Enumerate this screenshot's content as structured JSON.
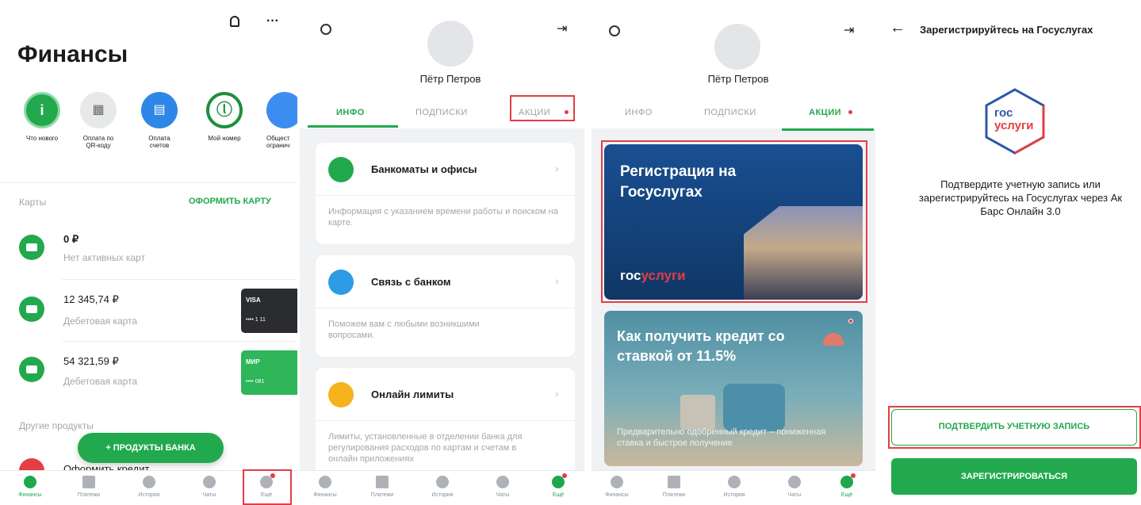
{
  "s1": {
    "title": "Финансы",
    "stories": [
      "Что нового",
      "Оплата по QR-коду",
      "Оплата счетов",
      "Мой номер",
      "Общест огранич"
    ],
    "cards_label": "Карты",
    "cards_action": "ОФОРМИТЬ КАРТУ",
    "accounts": [
      {
        "amount": "0 ₽",
        "desc": "Нет активных карт"
      },
      {
        "amount": "12 345,74 ₽",
        "desc": "Дебетовая карта",
        "chip_brand": "VISA",
        "chip_num": "•••• 1 11"
      },
      {
        "amount": "54 321,59 ₽",
        "desc": "Дебетовая карта",
        "chip_brand": "МИР",
        "chip_num": "•••• 081"
      }
    ],
    "other_label": "Другие продукты",
    "products_btn": "+ ПРОДУКТЫ БАНКА",
    "credit": "Оформить кредит"
  },
  "tabs": [
    "Финансы",
    "Платежи",
    "История",
    "Чаты",
    "Ещё"
  ],
  "profile": {
    "name": "Пётр Петров",
    "tab_info": "ИНФО",
    "tab_subs": "ПОДПИСКИ",
    "tab_promo": "АКЦИИ"
  },
  "s2": {
    "items": [
      {
        "title": "Банкоматы и офисы",
        "desc": "Информация с указанием времени работы и поиском на карте."
      },
      {
        "title": "Связь с банком",
        "desc": "Поможем вам с любыми возникшими вопросами."
      },
      {
        "title": "Онлайн лимиты",
        "desc": "Лимиты, установленные в отделении банка для регулирования расходов по картам и счетам в онлайн приложениях"
      }
    ]
  },
  "s3": {
    "promo1_title": "Регистрация на Госуслугах",
    "promo1_logo_a": "гос",
    "promo1_logo_b": "услуги",
    "promo2_title": "Как получить кредит со ставкой от 11.5%",
    "promo2_sub": "Предварительно одобренный кредит – пониженная ставка и быстрое получение"
  },
  "s4": {
    "title": "Зарегистрируйтесь на Госуслугах",
    "logo_a": "гос",
    "logo_b": "услуги",
    "text": "Подтвердите учетную запись или зарегистрируйтесь на Госуслугах через Ак Барс Онлайн 3.0",
    "btn_confirm": "ПОДТВЕРДИТЬ УЧЕТНУЮ ЗАПИСЬ",
    "btn_register": "ЗАРЕГИСТРИРОВАТЬСЯ"
  },
  "colors": {
    "green": "#22a94d",
    "red": "#e43d44",
    "blue": "#1c5fa8"
  }
}
